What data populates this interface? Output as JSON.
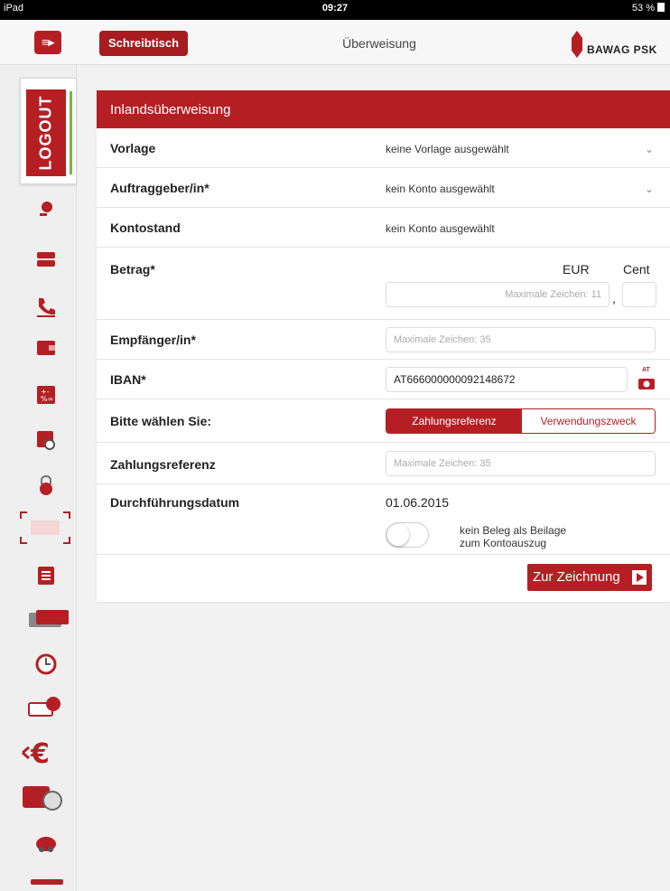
{
  "status_bar": {
    "device": "iPad",
    "time": "09:27",
    "battery": "53 %"
  },
  "header": {
    "desk_button": "Schreibtisch",
    "title": "Überweisung",
    "logo_text": "BAWAG PSK"
  },
  "sidebar": {
    "logout_label": "LOGOUT"
  },
  "form": {
    "title": "Inlandsüberweisung",
    "template": {
      "label": "Vorlage",
      "value": "keine Vorlage ausgewählt"
    },
    "payer": {
      "label": "Auftraggeber/in*",
      "value": "kein Konto ausgewählt"
    },
    "balance": {
      "label": "Kontostand",
      "value": "kein Konto ausgewählt"
    },
    "amount": {
      "label": "Betrag*",
      "eur_label": "EUR",
      "cent_label": "Cent",
      "eur_placeholder": "Maximale Zeichen: 11",
      "separator": ","
    },
    "recipient": {
      "label": "Empfänger/in*",
      "placeholder": "Maximale Zeichen: 35"
    },
    "iban": {
      "label": "IBAN*",
      "value": "AT666000000092148672",
      "scan_icon_badge": "AT"
    },
    "choice": {
      "label": "Bitte wählen Sie:",
      "options": [
        "Zahlungsreferenz",
        "Verwendungszweck"
      ],
      "selected": "Zahlungsreferenz"
    },
    "reference": {
      "label": "Zahlungsreferenz",
      "placeholder": "Maximale Zeichen: 35"
    },
    "execution_date": {
      "label": "Durchführungsdatum",
      "value": "01.06.2015",
      "toggle_label_line1": "kein Beleg als Beilage",
      "toggle_label_line2": "zum Kontoauszug",
      "toggle_on": false
    },
    "submit_label": "Zur Zeichnung"
  },
  "colors": {
    "brand_red": "#b51f24",
    "background": "#f2f2f2"
  }
}
